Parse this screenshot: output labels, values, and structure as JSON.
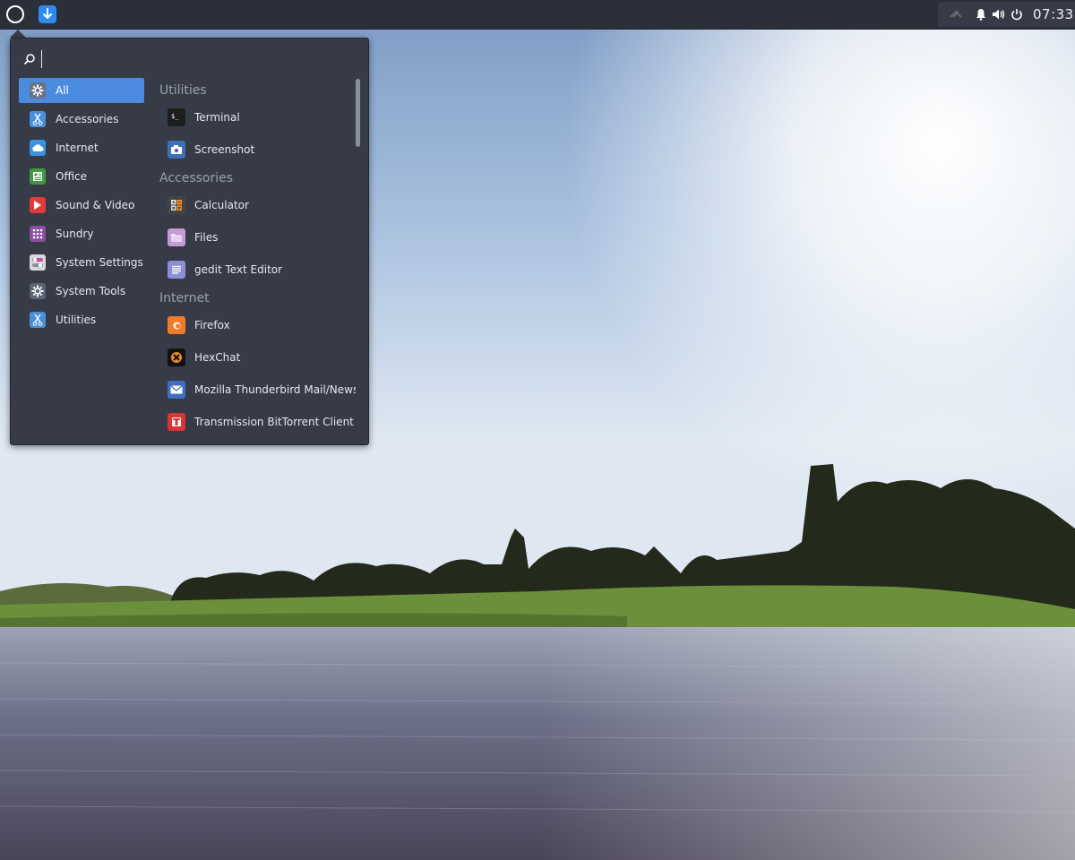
{
  "panel": {
    "menu_button_icon": "circle-menu-icon",
    "update_icon": "download-arrow-icon",
    "tray_icons": [
      "network-icon",
      "bell-icon",
      "volume-icon",
      "power-icon"
    ],
    "clock": "07:33",
    "accent": "#2d8cf0"
  },
  "menu": {
    "search": {
      "value": "",
      "placeholder": ""
    },
    "categories": [
      {
        "label": "All",
        "icon": "gear-icon",
        "color": "#6b7382",
        "active": true
      },
      {
        "label": "Accessories",
        "icon": "scissors-icon",
        "color": "#4a90d9"
      },
      {
        "label": "Internet",
        "icon": "cloud-icon",
        "color": "#3b93e0"
      },
      {
        "label": "Office",
        "icon": "document-icon",
        "color": "#3c9a3c"
      },
      {
        "label": "Sound & Video",
        "icon": "play-icon",
        "color": "#e03b3b"
      },
      {
        "label": "Sundry",
        "icon": "grid-icon",
        "color": "#8a4fa0"
      },
      {
        "label": "System Settings",
        "icon": "toggle-icon",
        "color": "#d8d8de"
      },
      {
        "label": "System Tools",
        "icon": "gear-icon",
        "color": "#5b6472"
      },
      {
        "label": "Utilities",
        "icon": "scissors-icon",
        "color": "#4a90d9"
      }
    ],
    "sections": [
      {
        "title": "Utilities",
        "apps": [
          {
            "label": "Terminal",
            "icon": "terminal-icon",
            "color": "#1e1e1e"
          },
          {
            "label": "Screenshot",
            "icon": "camera-icon",
            "color": "#3d6fb6"
          }
        ]
      },
      {
        "title": "Accessories",
        "apps": [
          {
            "label": "Calculator",
            "icon": "calculator-icon",
            "color": "#444"
          },
          {
            "label": "Files",
            "icon": "folder-icon",
            "color": "#c59ad6"
          },
          {
            "label": "gedit Text Editor",
            "icon": "text-editor-icon",
            "color": "#8b8fd8"
          }
        ]
      },
      {
        "title": "Internet",
        "apps": [
          {
            "label": "Firefox",
            "icon": "firefox-icon",
            "color": "#f07c2a"
          },
          {
            "label": "HexChat",
            "icon": "hexchat-icon",
            "color": "#111"
          },
          {
            "label": "Mozilla Thunderbird Mail/News",
            "icon": "mail-icon",
            "color": "#3f6fc4"
          },
          {
            "label": "Transmission BitTorrent Client",
            "icon": "transmission-icon",
            "color": "#d33"
          }
        ]
      }
    ],
    "scroll_fraction": 0.0
  }
}
